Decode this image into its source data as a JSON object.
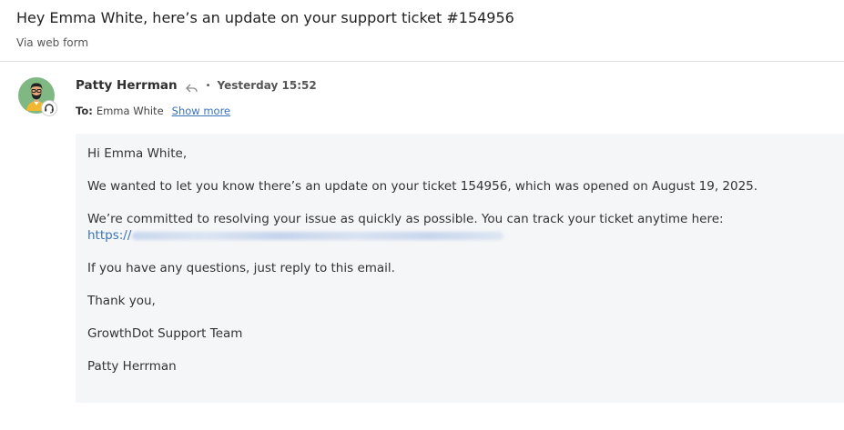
{
  "header": {
    "subject": "Hey Emma White, here’s an update on your support ticket #154956",
    "via": "Via web form"
  },
  "message": {
    "sender_name": "Patty Herrman",
    "separator": "•",
    "timestamp": "Yesterday 15:52",
    "to_label": "To:",
    "to_value": "Emma White",
    "show_more": "Show more",
    "avatar_color": "#7fb882"
  },
  "body": {
    "greeting": "Hi Emma White,",
    "p1": "We wanted to let you know there’s an update on your ticket 154956, which was opened on August 19, 2025.",
    "p2": "We’re committed to resolving your issue as quickly as possible. You can track your ticket anytime here:",
    "link_prefix": "https://",
    "p3": "If you have any questions, just reply to this email.",
    "closing": "Thank you,",
    "team": "GrowthDot Support Team",
    "signature": "Patty Herrman"
  },
  "icons": {
    "reply": "reply-icon",
    "avatar_badge": "headset-icon"
  },
  "colors": {
    "link": "#3b73b9",
    "body_background": "#f5f6f7"
  }
}
